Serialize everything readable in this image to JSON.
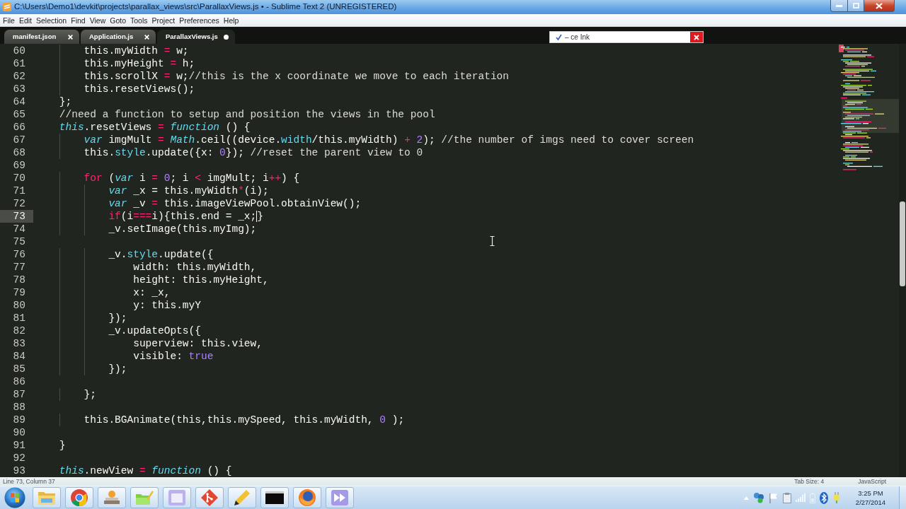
{
  "window": {
    "title": "C:\\Users\\Demo1\\devkit\\projects\\parallax_views\\src\\ParallaxViews.js • - Sublime Text 2 (UNREGISTERED)"
  },
  "menu": [
    "File",
    "Edit",
    "Selection",
    "Find",
    "View",
    "Goto",
    "Tools",
    "Project",
    "Preferences",
    "Help"
  ],
  "tabs": [
    {
      "label": "manifest.json",
      "selected": false,
      "dirty": false
    },
    {
      "label": "Application.js",
      "selected": false,
      "dirty": false
    },
    {
      "label": "ParallaxViews.js",
      "selected": true,
      "dirty": true
    }
  ],
  "notification": {
    "text": "– ce Ink"
  },
  "editor": {
    "lines": [
      {
        "number": "60",
        "current": false,
        "tokens": [
          {
            "kind": "plain",
            "text": "        this.myWidth "
          },
          {
            "kind": "keyword",
            "text": "="
          },
          {
            "kind": "plain",
            "text": " w;"
          }
        ]
      },
      {
        "number": "61",
        "current": false,
        "tokens": [
          {
            "kind": "plain",
            "text": "        this.myHeight "
          },
          {
            "kind": "keyword",
            "text": "="
          },
          {
            "kind": "plain",
            "text": " h;"
          }
        ]
      },
      {
        "number": "62",
        "current": false,
        "tokens": [
          {
            "kind": "plain",
            "text": "        this.scrollX "
          },
          {
            "kind": "keyword",
            "text": "="
          },
          {
            "kind": "plain",
            "text": " w;"
          },
          {
            "kind": "comment",
            "text": "//this is the x coordinate we move to each iteration"
          }
        ]
      },
      {
        "number": "63",
        "current": false,
        "tokens": [
          {
            "kind": "plain",
            "text": "        this.resetViews();"
          }
        ]
      },
      {
        "number": "64",
        "current": false,
        "tokens": [
          {
            "kind": "plain",
            "text": "    };"
          }
        ]
      },
      {
        "number": "65",
        "current": false,
        "tokens": [
          {
            "kind": "comment",
            "text": "    //need a function to setup and position the views in the pool"
          }
        ]
      },
      {
        "number": "66",
        "current": false,
        "tokens": [
          {
            "kind": "storage",
            "text": "    this"
          },
          {
            "kind": "plain",
            "text": ".resetViews "
          },
          {
            "kind": "keyword",
            "text": "= "
          },
          {
            "kind": "storage",
            "text": "function"
          },
          {
            "kind": "plain",
            "text": " () {"
          }
        ]
      },
      {
        "number": "67",
        "current": false,
        "tokens": [
          {
            "kind": "storage",
            "text": "        var"
          },
          {
            "kind": "plain",
            "text": " imgMult "
          },
          {
            "kind": "keyword",
            "text": "= "
          },
          {
            "kind": "storage",
            "text": "Math"
          },
          {
            "kind": "plain",
            "text": ".ceil((device."
          },
          {
            "kind": "support",
            "text": "width"
          },
          {
            "kind": "plain",
            "text": "/this.myWidth) "
          },
          {
            "kind": "keyword",
            "text": "+ "
          },
          {
            "kind": "number",
            "text": "2"
          },
          {
            "kind": "plain",
            "text": "); "
          },
          {
            "kind": "comment",
            "text": "//the number of imgs need to cover screen"
          }
        ]
      },
      {
        "number": "68",
        "current": false,
        "tokens": [
          {
            "kind": "plain",
            "text": "        this."
          },
          {
            "kind": "support",
            "text": "style"
          },
          {
            "kind": "plain",
            "text": ".update({x: "
          },
          {
            "kind": "number",
            "text": "0"
          },
          {
            "kind": "plain",
            "text": "}); "
          },
          {
            "kind": "comment",
            "text": "//reset the parent view to 0"
          }
        ]
      },
      {
        "number": "69",
        "current": false
      },
      {
        "number": "70",
        "current": false,
        "tokens": [
          {
            "kind": "keyword",
            "text": "        for"
          },
          {
            "kind": "plain",
            "text": " ("
          },
          {
            "kind": "storage",
            "text": "var"
          },
          {
            "kind": "plain",
            "text": " i "
          },
          {
            "kind": "keyword",
            "text": "= "
          },
          {
            "kind": "number",
            "text": "0"
          },
          {
            "kind": "plain",
            "text": "; i "
          },
          {
            "kind": "keyword",
            "text": "<"
          },
          {
            "kind": "plain",
            "text": " imgMult; i"
          },
          {
            "kind": "keyword",
            "text": "++"
          },
          {
            "kind": "plain",
            "text": ") {"
          }
        ]
      },
      {
        "number": "71",
        "current": false,
        "tokens": [
          {
            "kind": "storage",
            "text": "            var"
          },
          {
            "kind": "plain",
            "text": " _x = this.myWidth"
          },
          {
            "kind": "keyword",
            "text": "*"
          },
          {
            "kind": "plain",
            "text": "(i);"
          }
        ]
      },
      {
        "number": "72",
        "current": false,
        "tokens": [
          {
            "kind": "storage",
            "text": "            var"
          },
          {
            "kind": "plain",
            "text": " _v "
          },
          {
            "kind": "keyword",
            "text": "="
          },
          {
            "kind": "plain",
            "text": " this.imageViewPool.obtainView();"
          }
        ]
      },
      {
        "number": "73",
        "current": true,
        "tokens": [
          {
            "kind": "keyword",
            "text": "            if"
          },
          {
            "kind": "plain",
            "text": "(i"
          },
          {
            "kind": "keyword",
            "text": "==="
          },
          {
            "kind": "plain",
            "text": "i){this.end = _x;"
          },
          {
            "kind": "caret"
          },
          {
            "kind": "plain",
            "text": "}"
          }
        ]
      },
      {
        "number": "74",
        "current": false,
        "tokens": [
          {
            "kind": "plain",
            "text": "            _v.setImage(this.myImg);"
          }
        ]
      },
      {
        "number": "75",
        "current": false
      },
      {
        "number": "76",
        "current": false,
        "tokens": [
          {
            "kind": "plain",
            "text": "            _v."
          },
          {
            "kind": "support",
            "text": "style"
          },
          {
            "kind": "plain",
            "text": ".update({"
          }
        ]
      },
      {
        "number": "77",
        "current": false,
        "tokens": [
          {
            "kind": "plain",
            "text": "                width: this.myWidth,"
          }
        ]
      },
      {
        "number": "78",
        "current": false,
        "tokens": [
          {
            "kind": "plain",
            "text": "                height: this.myHeight,"
          }
        ]
      },
      {
        "number": "79",
        "current": false,
        "tokens": [
          {
            "kind": "plain",
            "text": "                x: _x,"
          }
        ]
      },
      {
        "number": "80",
        "current": false,
        "tokens": [
          {
            "kind": "plain",
            "text": "                y: this.myY"
          }
        ]
      },
      {
        "number": "81",
        "current": false,
        "tokens": [
          {
            "kind": "plain",
            "text": "            });"
          }
        ]
      },
      {
        "number": "82",
        "current": false,
        "tokens": [
          {
            "kind": "plain",
            "text": "            _v.updateOpts({"
          }
        ]
      },
      {
        "number": "83",
        "current": false,
        "tokens": [
          {
            "kind": "plain",
            "text": "                superview: this.view,"
          }
        ]
      },
      {
        "number": "84",
        "current": false,
        "tokens": [
          {
            "kind": "plain",
            "text": "                visible: "
          },
          {
            "kind": "number",
            "text": "true"
          }
        ]
      },
      {
        "number": "85",
        "current": false,
        "tokens": [
          {
            "kind": "plain",
            "text": "            });"
          }
        ]
      },
      {
        "number": "86",
        "current": false
      },
      {
        "number": "87",
        "current": false,
        "tokens": [
          {
            "kind": "plain",
            "text": "        };"
          }
        ]
      },
      {
        "number": "88",
        "current": false
      },
      {
        "number": "89",
        "current": false,
        "tokens": [
          {
            "kind": "plain",
            "text": "        this.BGAnimate(this,this.mySpeed, this.myWidth, "
          },
          {
            "kind": "number",
            "text": "0"
          },
          {
            "kind": "plain",
            "text": " );"
          }
        ]
      },
      {
        "number": "90",
        "current": false
      },
      {
        "number": "91",
        "current": false,
        "tokens": [
          {
            "kind": "plain",
            "text": "    }"
          }
        ]
      },
      {
        "number": "92",
        "current": false
      },
      {
        "number": "93",
        "current": false,
        "tokens": [
          {
            "kind": "storage",
            "text": "    this"
          },
          {
            "kind": "plain",
            "text": ".newView "
          },
          {
            "kind": "keyword",
            "text": "= "
          },
          {
            "kind": "storage",
            "text": "function"
          },
          {
            "kind": "plain",
            "text": " () {"
          }
        ]
      }
    ]
  },
  "status_bar": {
    "position": "Line 73, Column 37",
    "tab_size": "Tab Size: 4",
    "syntax": "JavaScript"
  },
  "clock": {
    "time": "3:25 PM",
    "date": "2/27/2014"
  }
}
